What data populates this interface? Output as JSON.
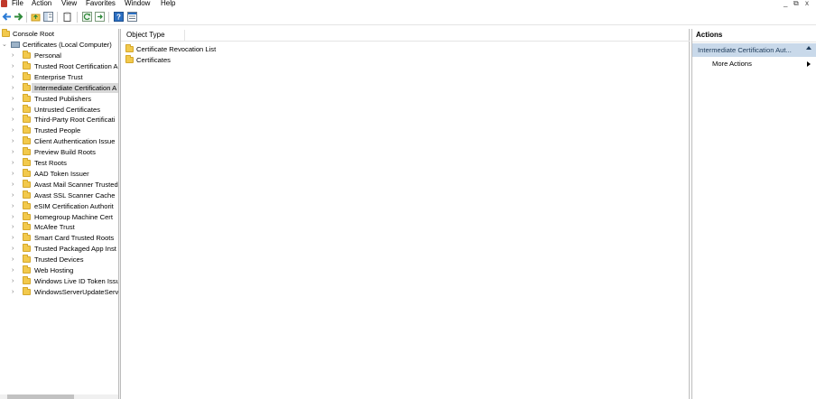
{
  "menu": {
    "items": [
      "File",
      "Action",
      "View",
      "Favorites",
      "Window",
      "Help"
    ],
    "window_controls": [
      "_",
      "⧉",
      "x"
    ]
  },
  "toolbar": {
    "buttons": [
      "back-icon",
      "forward-icon",
      "up-folder-icon",
      "show-hide-tree-icon",
      "export-list-icon",
      "refresh-icon",
      "export-icon",
      "help-icon",
      "properties-icon"
    ]
  },
  "tree": {
    "root": "Console Root",
    "store": "Certificates (Local Computer)",
    "items": [
      {
        "label": "Personal",
        "selected": false
      },
      {
        "label": "Trusted Root Certification A",
        "selected": false
      },
      {
        "label": "Enterprise Trust",
        "selected": false
      },
      {
        "label": "Intermediate Certification A",
        "selected": true
      },
      {
        "label": "Trusted Publishers",
        "selected": false
      },
      {
        "label": "Untrusted Certificates",
        "selected": false
      },
      {
        "label": "Third-Party Root Certificati",
        "selected": false
      },
      {
        "label": "Trusted People",
        "selected": false
      },
      {
        "label": "Client Authentication Issue",
        "selected": false
      },
      {
        "label": "Preview Build Roots",
        "selected": false
      },
      {
        "label": "Test Roots",
        "selected": false
      },
      {
        "label": "AAD Token Issuer",
        "selected": false
      },
      {
        "label": "Avast Mail Scanner Trusted",
        "selected": false
      },
      {
        "label": "Avast SSL Scanner Cache",
        "selected": false
      },
      {
        "label": "eSIM Certification Authorit",
        "selected": false
      },
      {
        "label": "Homegroup Machine Cert",
        "selected": false
      },
      {
        "label": "McAfee Trust",
        "selected": false
      },
      {
        "label": "Smart Card Trusted Roots",
        "selected": false
      },
      {
        "label": "Trusted Packaged App Inst",
        "selected": false
      },
      {
        "label": "Trusted Devices",
        "selected": false
      },
      {
        "label": "Web Hosting",
        "selected": false
      },
      {
        "label": "Windows Live ID Token Issu",
        "selected": false
      },
      {
        "label": "WindowsServerUpdateServ",
        "selected": false
      }
    ]
  },
  "list": {
    "column_header": "Object Type",
    "rows": [
      "Certificate Revocation List",
      "Certificates"
    ]
  },
  "actions": {
    "title": "Actions",
    "section": "Intermediate Certification Aut...",
    "more_actions": "More Actions"
  }
}
